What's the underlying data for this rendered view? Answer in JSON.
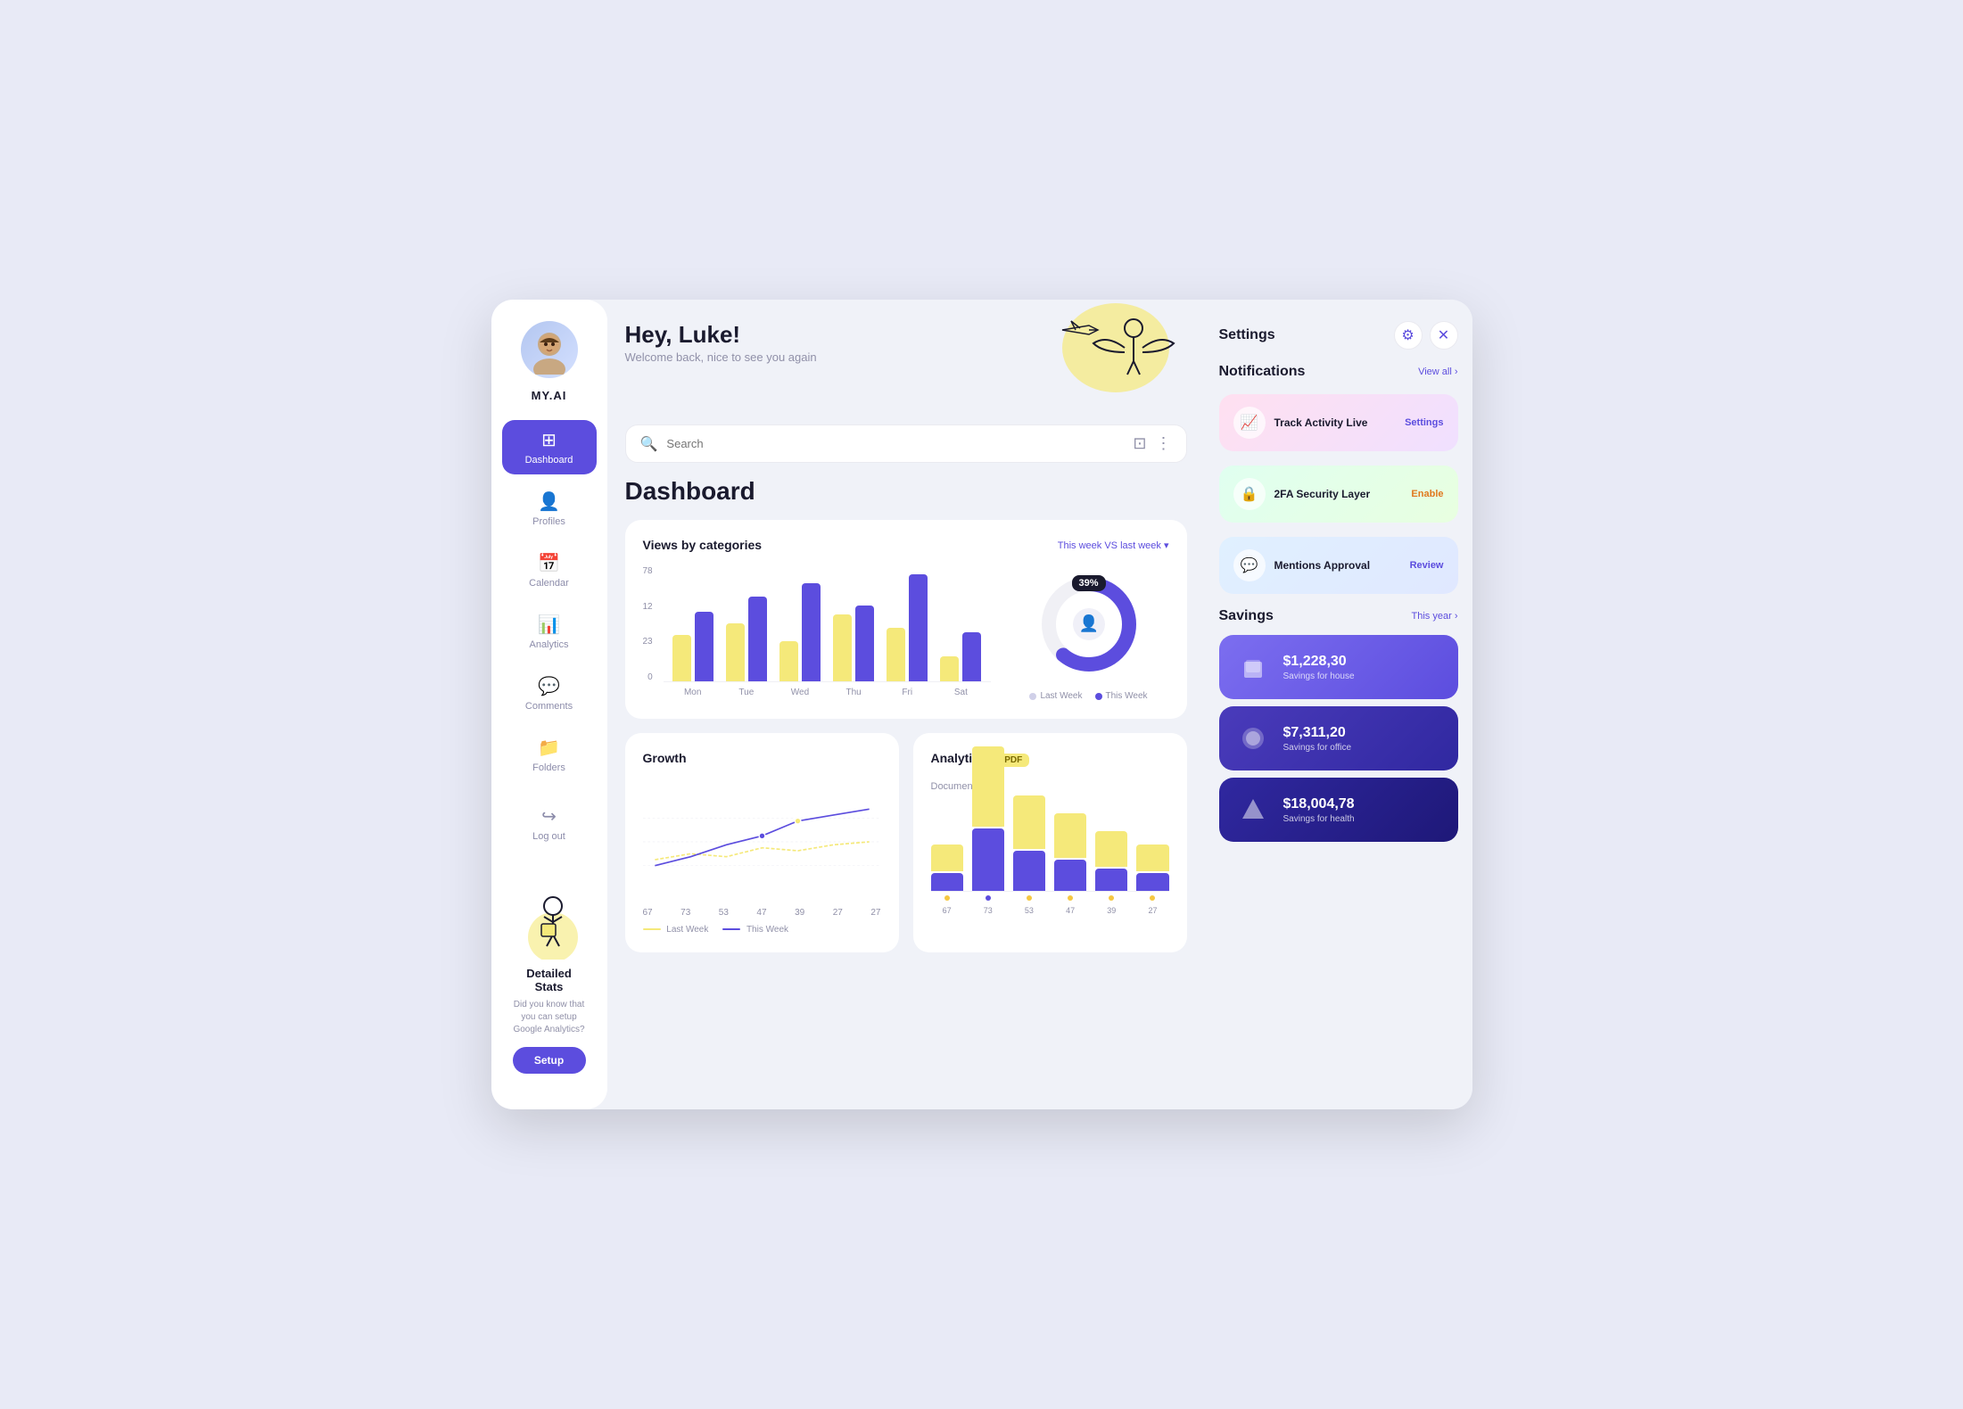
{
  "app": {
    "name": "MY.AI"
  },
  "header": {
    "greeting": "Hey, Luke!",
    "subtitle": "Welcome back, nice to see you again",
    "settings_label": "Settings",
    "close_label": "×"
  },
  "search": {
    "placeholder": "Search"
  },
  "dashboard": {
    "title": "Dashboard"
  },
  "nav": {
    "items": [
      {
        "id": "dashboard",
        "label": "Dashboard",
        "active": true
      },
      {
        "id": "profiles",
        "label": "Profiles",
        "active": false
      },
      {
        "id": "calendar",
        "label": "Calendar",
        "active": false
      },
      {
        "id": "analytics",
        "label": "Analytics",
        "active": false
      },
      {
        "id": "comments",
        "label": "Comments",
        "active": false
      },
      {
        "id": "folders",
        "label": "Folders",
        "active": false
      }
    ],
    "logout_label": "Log out"
  },
  "detailed_stats": {
    "title": "Detailed Stats",
    "description": "Did you know that you can setup Google Analytics?",
    "button_label": "Setup"
  },
  "views_chart": {
    "title": "Views by categories",
    "filter": "This week VS last week ▾",
    "y_labels": [
      "78",
      "12",
      "23",
      "0"
    ],
    "x_labels": [
      "Mon",
      "Tue",
      "Wed",
      "Thu",
      "Fri",
      "Sat"
    ],
    "bars_last_week": [
      40,
      55,
      35,
      60,
      50,
      20
    ],
    "bars_this_week": [
      60,
      80,
      90,
      70,
      100,
      45
    ],
    "donut_percent": "39%",
    "legend_last_week": "Last Week",
    "legend_this_week": "This Week"
  },
  "growth_chart": {
    "title": "Growth",
    "x_labels": [
      "67",
      "73",
      "53",
      "47",
      "39",
      "27",
      "27"
    ],
    "legend_last_week": "Last Week",
    "legend_this_week": "This Week"
  },
  "analytics_chart": {
    "title": "Analytics",
    "subtitle": "Documents",
    "badge": "PDF",
    "x_labels": [
      "67",
      "73",
      "53",
      "47",
      "39",
      "27"
    ],
    "bars_last_week": [
      30,
      90,
      60,
      50,
      40,
      30
    ],
    "bars_this_week": [
      20,
      70,
      45,
      35,
      25,
      20
    ]
  },
  "notifications": {
    "title": "Notifications",
    "view_all": "View all ›",
    "items": [
      {
        "id": "track-activity",
        "label": "Track Activity Live",
        "action": "Settings",
        "color": "pink"
      },
      {
        "id": "2fa",
        "label": "2FA Security Layer",
        "action": "Enable",
        "color": "green"
      },
      {
        "id": "mentions",
        "label": "Mentions Approval",
        "action": "Review",
        "color": "blue"
      }
    ]
  },
  "settings_panel": {
    "title": "Settings"
  },
  "savings": {
    "title": "Savings",
    "filter": "This year ›",
    "items": [
      {
        "amount": "$1,228,30",
        "description": "Savings for house",
        "color": "purple"
      },
      {
        "amount": "$7,311,20",
        "description": "Savings for office",
        "color": "dark-purple"
      },
      {
        "amount": "$18,004,78",
        "description": "Savings for health",
        "color": "deep"
      }
    ]
  }
}
